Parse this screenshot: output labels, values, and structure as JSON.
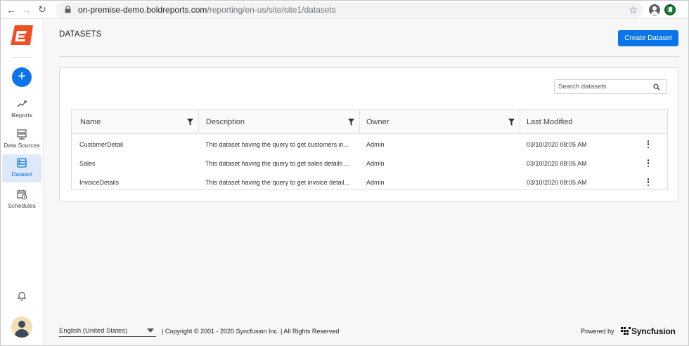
{
  "browser": {
    "url_host": "on-premise-demo.boldreports.com",
    "url_path": "/reporting/en-us/site/site1/datasets"
  },
  "sidebar": {
    "items": [
      {
        "label": "Reports",
        "icon": "trending-up-icon"
      },
      {
        "label": "Data Sources",
        "icon": "server-icon"
      },
      {
        "label": "Dataset",
        "icon": "dataset-icon",
        "active": true
      },
      {
        "label": "Schedules",
        "icon": "calendar-clock-icon"
      }
    ],
    "add_label": "+"
  },
  "header": {
    "title": "DATASETS",
    "create_label": "Create Dataset"
  },
  "search": {
    "placeholder": "Search datasets"
  },
  "grid": {
    "columns": [
      "Name",
      "Description",
      "Owner",
      "Last Modified"
    ],
    "rows": [
      {
        "name": "CustomerDetail",
        "description": "This dataset having the query to get customers in...",
        "owner": "Admin",
        "modified": "03/10/2020 08:05 AM"
      },
      {
        "name": "Sales",
        "description": "This dataset having the query to get sales details ...",
        "owner": "Admin",
        "modified": "03/10/2020 08:05 AM"
      },
      {
        "name": "InvoiceDetails",
        "description": "This dataset having the query to get invoice detail...",
        "owner": "Admin",
        "modified": "03/10/2020 08:05 AM"
      }
    ]
  },
  "footer": {
    "language": "English (United States)",
    "copyright": "|   Copyright © 2001 - 2020 Syncfusion Inc.   |   All Rights Reserved",
    "powered_by": "Powered by",
    "brand": "Syncfusion"
  },
  "colors": {
    "accent": "#0a74e9",
    "logo": "#f04e23"
  }
}
